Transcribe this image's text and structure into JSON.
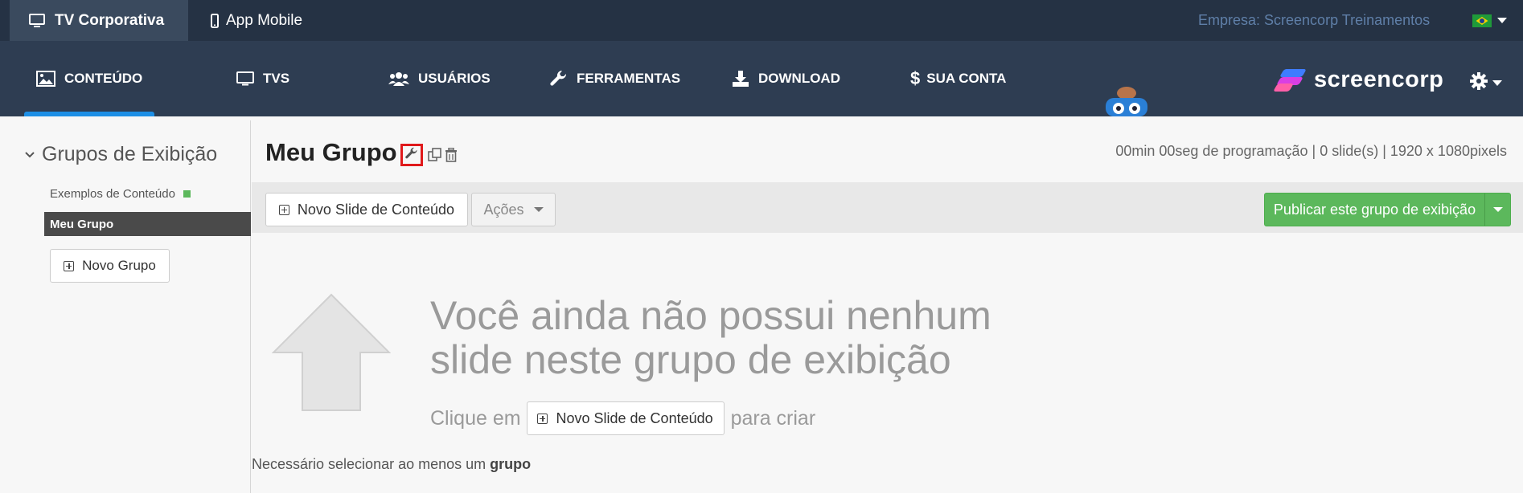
{
  "topbar": {
    "tab_tv": "TV Corporativa",
    "tab_app": "App Mobile",
    "company": "Empresa: Screencorp Treinamentos",
    "flag_icon": "brazil-flag-icon"
  },
  "nav": {
    "items": [
      {
        "label": "CONTEÚDO",
        "icon": "image-icon"
      },
      {
        "label": "TVS",
        "icon": "monitor-icon"
      },
      {
        "label": "USUÁRIOS",
        "icon": "users-icon"
      },
      {
        "label": "FERRAMENTAS",
        "icon": "wrench-icon"
      },
      {
        "label": "DOWNLOAD",
        "icon": "download-icon"
      },
      {
        "label": "SUA CONTA",
        "icon": "dollar-icon"
      }
    ],
    "logo": "screencorp",
    "accent": "#1d8fe6"
  },
  "sidebar": {
    "title": "Grupos de Exibição",
    "items": [
      {
        "label": "Exemplos de Conteúdo",
        "status_color": "#5cb85c"
      },
      {
        "label": "Meu Grupo",
        "active": true
      }
    ],
    "new_group": "Novo Grupo"
  },
  "main": {
    "title": "Meu Grupo",
    "stats": "00min 00seg de programação | 0 slide(s) | 1920 x 1080pixels",
    "new_slide": "Novo Slide de Conteúdo",
    "actions": "Ações",
    "publish": "Publicar este grupo de exibição",
    "publish_color": "#5cb85c",
    "empty_line1": "Você ainda não possui nenhum",
    "empty_line2": "slide neste grupo de exibição",
    "hint_before": "Clique em",
    "hint_button": "Novo Slide de Conteúdo",
    "hint_after": "para criar",
    "validation_text": "Necessário selecionar ao menos um",
    "validation_bold": "grupo"
  }
}
